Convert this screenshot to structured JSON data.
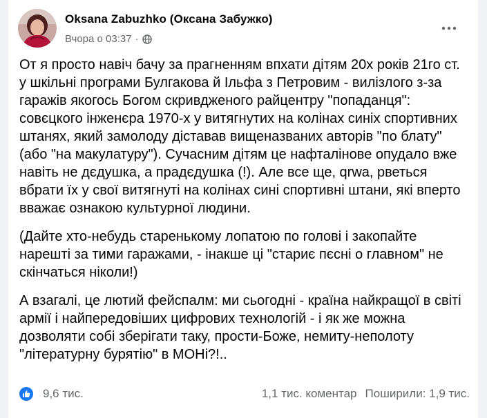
{
  "post": {
    "author": "Oksana Zabuzhko (Оксана Забужко)",
    "time": "Вчора о 03:37",
    "separator": "·",
    "paragraphs": [
      "От я просто навіч бачу за прагненням впхати дітям 20х років 21го ст. у шкільні програми Булгакова й Ільфа з Петровим - вилізлого з-за гаражів якогось Богом скривдженого райцентру \"попаданця\": совєцкого інженєра 1970-х у витягнутих на колінах синіх спортивних штанях, який замолоду діставав вищеназваних авторів \"по блату\" (або \"на макулатуру\"). Сучасним дітям це нафталінове опудало вже навіть не дєдушка, а прадєдушка (!). Але все ще, qrwa, рветься вбрати їх у свої витягнуті на колінах сині спортивні штани, які вперто вважає ознакою культурної людини.",
      "(Дайте хто-небудь старенькому лопатою по голові і закопайте нарешті за тими гаражами, - інакше ці \"стариє пєсні о главном\" не скінчаться ніколи!)",
      "А взагалі, це лютий фейспалм: ми сьогодні - країна найкращої в світі армії і найпередовіших цифрових технологій - і як же можна дозволяти собі зберігати таку, прости-Боже, немиту-неполоту \"літературну бурятію\" в МОНі?!.."
    ],
    "reactions": "9,6 тис.",
    "comments": "1,1 тис. коментар",
    "shares": "Поширили: 1,9 тис."
  },
  "icons": {
    "privacy": "globe-icon",
    "more": "more-options-icon",
    "reaction": "like-icon"
  },
  "colors": {
    "like_blue": "#1877f2",
    "secondary_text": "#65676b",
    "background": "#f0f2f5"
  }
}
